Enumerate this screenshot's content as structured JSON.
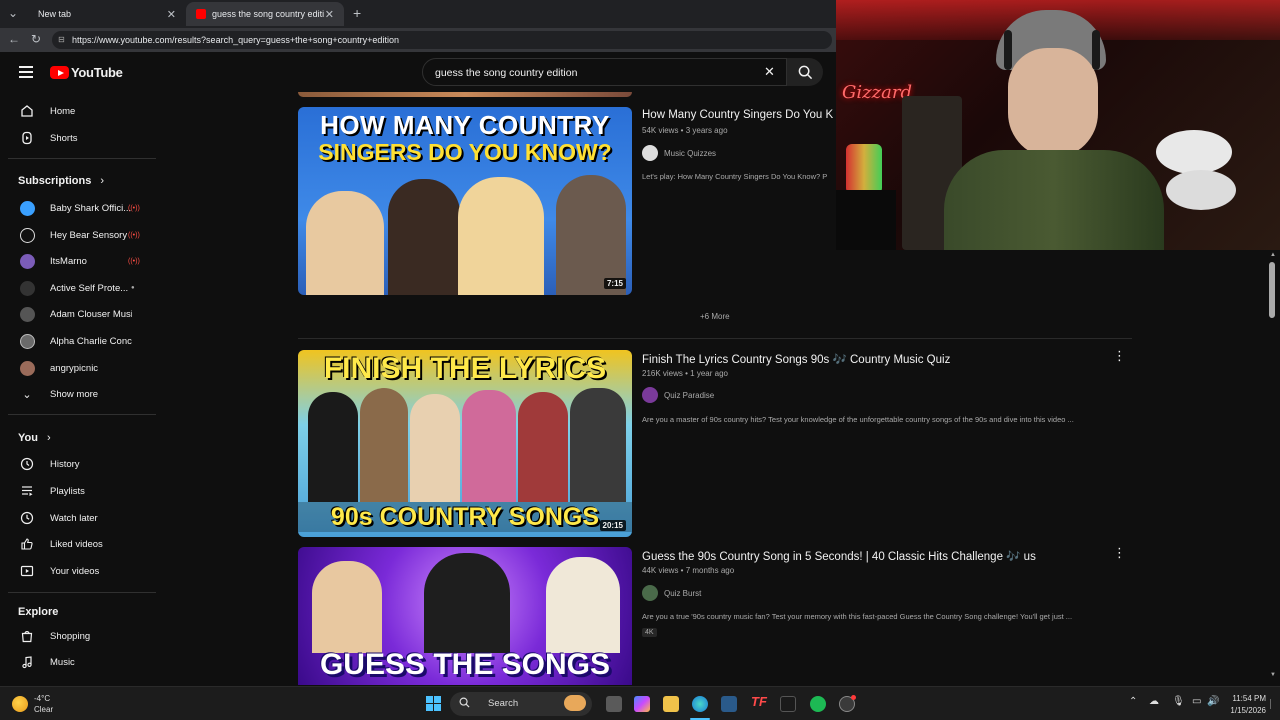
{
  "browser": {
    "tabs": [
      {
        "label": "New tab"
      },
      {
        "label": "guess the song country edition - Y"
      }
    ],
    "url": "https://www.youtube.com/results?search_query=guess+the+song+country+edition"
  },
  "header": {
    "logo_text": "YouTube",
    "search_value": "guess the song country edition"
  },
  "sidebar": {
    "main": [
      {
        "label": "Home",
        "icon": "home-icon"
      },
      {
        "label": "Shorts",
        "icon": "shorts-icon"
      }
    ],
    "subscriptions_title": "Subscriptions",
    "subscriptions": [
      {
        "label": "Baby Shark Offici...",
        "live": true,
        "color": "#3aa0ff"
      },
      {
        "label": "Hey Bear Sensory",
        "live": true,
        "color": "#222"
      },
      {
        "label": "ItsMarno",
        "live": true,
        "color": "#7b5cb8"
      },
      {
        "label": "Active Self Prote...",
        "live": false,
        "color": "#444"
      },
      {
        "label": "Adam Clouser Music",
        "live": false,
        "color": "#555"
      },
      {
        "label": "Alpha Charlie Conc...",
        "live": false,
        "color": "#6a6a6a"
      },
      {
        "label": "angrypicnic",
        "live": false,
        "color": "#9a6b5a"
      }
    ],
    "show_more": "Show more",
    "you_title": "You",
    "you": [
      {
        "label": "History",
        "icon": "history-icon"
      },
      {
        "label": "Playlists",
        "icon": "playlists-icon"
      },
      {
        "label": "Watch later",
        "icon": "watch-later-icon"
      },
      {
        "label": "Liked videos",
        "icon": "liked-icon"
      },
      {
        "label": "Your videos",
        "icon": "your-videos-icon"
      }
    ],
    "explore_title": "Explore",
    "explore": [
      {
        "label": "Shopping",
        "icon": "shopping-icon"
      },
      {
        "label": "Music",
        "icon": "music-icon"
      }
    ]
  },
  "results": [
    {
      "thumb_line1": "HOW MANY COUNTRY",
      "thumb_line2": "SINGERS DO YOU KNOW?",
      "duration": "7:15",
      "title": "How Many Country Singers Do You K",
      "meta": "54K views • 3 years ago",
      "channel": "Music Quizzes",
      "description": "Let's play: How Many Country Singers Do You Know? P"
    },
    {
      "thumb_line1": "FINISH THE LYRICS",
      "thumb_line2": "90s COUNTRY SONGS",
      "duration": "20:15",
      "title": "Finish The Lyrics Country Songs 90s 🎶 Country Music Quiz",
      "meta": "216K views • 1 year ago",
      "channel": "Quiz Paradise",
      "description": "Are you a master of 90s country hits? Test your knowledge of the unforgettable country songs of the 90s and dive into this video ..."
    },
    {
      "thumb_line1": "GUESS THE SONGS",
      "duration": "",
      "title": "Guess the 90s Country Song in 5 Seconds! | 40 Classic Hits Challenge 🎶 us",
      "meta": "44K views • 7 months ago",
      "channel": "Quiz Burst",
      "description": "Are you a true '90s country music fan? Test your memory with this fast-paced Guess the Country Song challenge! You'll get just ...",
      "badge": "4K"
    }
  ],
  "more_link": "+6 More",
  "webcam": {
    "neon_text": "Gizzard"
  },
  "taskbar": {
    "weather_temp": "-4°C",
    "weather_desc": "Clear",
    "search_label": "Search",
    "time": "11:54 PM",
    "date": "1/15/2026"
  }
}
